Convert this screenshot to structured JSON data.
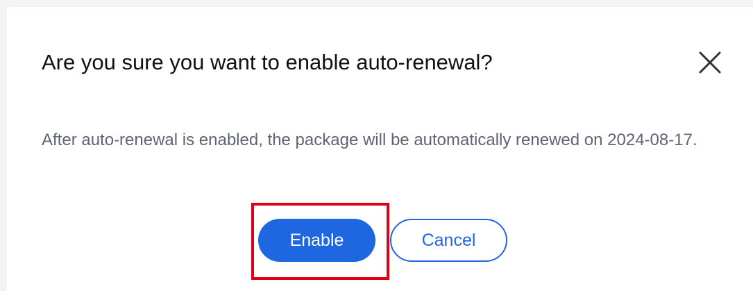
{
  "dialog": {
    "title": "Are you sure you want to enable auto-renewal?",
    "message": "After auto-renewal is enabled, the package will be automatically renewed on 2024-08-17.",
    "close_icon": "close-icon",
    "buttons": {
      "confirm_label": "Enable",
      "cancel_label": "Cancel"
    }
  },
  "colors": {
    "primary": "#1f66e1",
    "highlight": "#e00013",
    "text_primary": "#111111",
    "text_secondary": "#5e6472"
  }
}
